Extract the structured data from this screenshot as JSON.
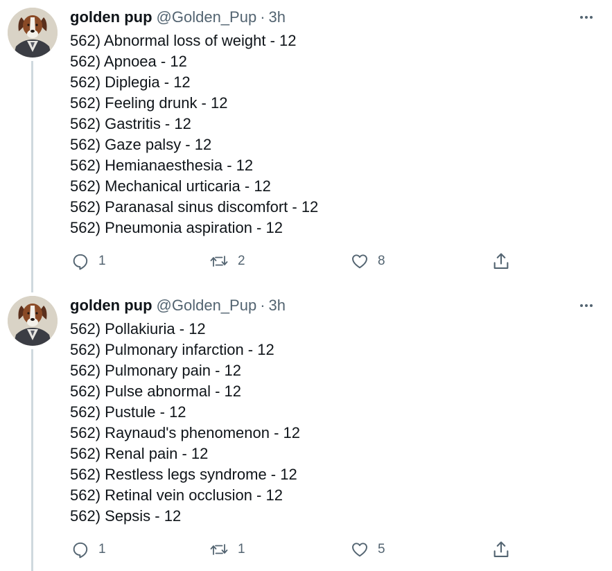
{
  "tweets": [
    {
      "user": {
        "name": "golden pup",
        "handle": "@Golden_Pup",
        "separator": "·",
        "time": "3h"
      },
      "lines": [
        "562) Abnormal loss of weight - 12",
        "562) Apnoea - 12",
        "562) Diplegia - 12",
        "562) Feeling drunk - 12",
        "562) Gastritis - 12",
        "562) Gaze palsy - 12",
        "562) Hemianaesthesia - 12",
        "562) Mechanical urticaria - 12",
        "562) Paranasal sinus discomfort - 12",
        "562) Pneumonia aspiration - 12"
      ],
      "stats": {
        "replies": "1",
        "retweets": "2",
        "likes": "8"
      }
    },
    {
      "user": {
        "name": "golden pup",
        "handle": "@Golden_Pup",
        "separator": "·",
        "time": "3h"
      },
      "lines": [
        "562) Pollakiuria - 12",
        "562) Pulmonary infarction - 12",
        "562) Pulmonary pain - 12",
        "562) Pulse abnormal - 12",
        "562) Pustule - 12",
        "562) Raynaud's phenomenon - 12",
        "562) Renal pain - 12",
        "562) Restless legs syndrome - 12",
        "562) Retinal vein occlusion - 12",
        "562) Sepsis - 12"
      ],
      "stats": {
        "replies": "1",
        "retweets": "1",
        "likes": "5"
      }
    }
  ],
  "icons": {
    "reply": "reply-icon",
    "retweet": "retweet-icon",
    "like": "like-icon",
    "share": "share-icon",
    "more": "more-icon"
  },
  "colors": {
    "text": "#0f1419",
    "secondary": "#536471",
    "thread_line": "#cfd9de"
  }
}
